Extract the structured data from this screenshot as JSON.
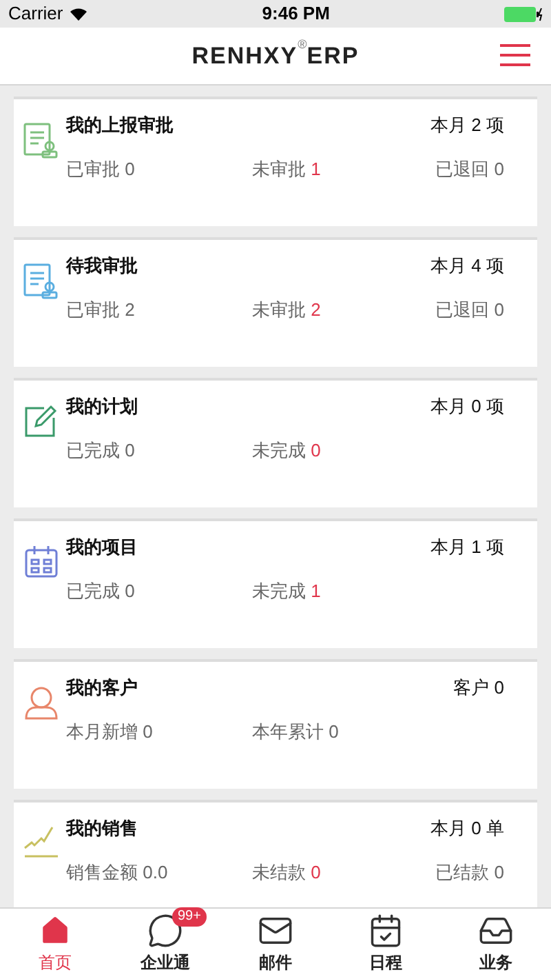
{
  "status_bar": {
    "carrier": "Carrier",
    "time": "9:46 PM"
  },
  "header": {
    "logo": "RENHXY",
    "logo_mark": "®",
    "logo_suffix": "ERP"
  },
  "cards": [
    {
      "title": "我的上报审批",
      "summary": "本月 2 项",
      "color": "#7ec07e",
      "stats": [
        {
          "label": "已审批",
          "value": "0",
          "alert": false
        },
        {
          "label": "未审批",
          "value": "1",
          "alert": true
        },
        {
          "label": "已退回",
          "value": "0",
          "alert": false
        }
      ]
    },
    {
      "title": "待我审批",
      "summary": "本月 4 项",
      "color": "#5aaee0",
      "stats": [
        {
          "label": "已审批",
          "value": "2",
          "alert": false
        },
        {
          "label": "未审批",
          "value": "2",
          "alert": true
        },
        {
          "label": "已退回",
          "value": "0",
          "alert": false
        }
      ]
    },
    {
      "title": "我的计划",
      "summary": "本月 0 项",
      "color": "#3a9a6a",
      "stats": [
        {
          "label": "已完成",
          "value": "0",
          "alert": false
        },
        {
          "label": "未完成",
          "value": "0",
          "alert": true
        }
      ]
    },
    {
      "title": "我的项目",
      "summary": "本月 1 项",
      "color": "#6f7fd6",
      "stats": [
        {
          "label": "已完成",
          "value": "0",
          "alert": false
        },
        {
          "label": "未完成",
          "value": "1",
          "alert": true
        }
      ]
    },
    {
      "title": "我的客户",
      "summary": "客户 0",
      "color": "#e8866a",
      "stats": [
        {
          "label": "本月新增",
          "value": "0",
          "alert": false
        },
        {
          "label": "本年累计",
          "value": "0",
          "alert": false
        }
      ]
    },
    {
      "title": "我的销售",
      "summary": "本月 0 单",
      "color": "#c8c060",
      "stats": [
        {
          "label": "销售金额",
          "value": "0.0",
          "alert": false
        },
        {
          "label": "未结款",
          "value": "0",
          "alert": true
        },
        {
          "label": "已结款",
          "value": "0",
          "alert": false
        }
      ]
    }
  ],
  "tab_bar": [
    {
      "label": "首页",
      "selected": true
    },
    {
      "label": "企业通",
      "selected": false,
      "badge": "99+"
    },
    {
      "label": "邮件",
      "selected": false
    },
    {
      "label": "日程",
      "selected": false
    },
    {
      "label": "业务",
      "selected": false
    }
  ]
}
